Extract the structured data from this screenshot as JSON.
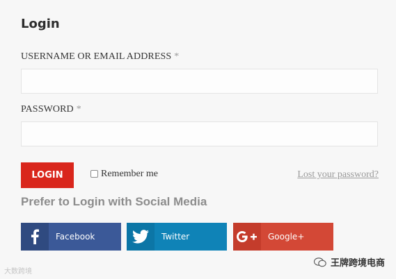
{
  "form": {
    "title": "Login",
    "username_label": "USERNAME OR EMAIL ADDRESS",
    "required_mark": "*",
    "username_value": "",
    "password_label": "PASSWORD",
    "password_value": "",
    "login_button": "LOGIN",
    "remember_label": "Remember me",
    "remember_checked": false,
    "lost_password": "Lost your password?"
  },
  "social": {
    "heading": "Prefer to Login with Social Media",
    "buttons": [
      {
        "label": "Facebook",
        "icon": "facebook-icon",
        "color": "#3b5998"
      },
      {
        "label": "Twitter",
        "icon": "twitter-icon",
        "color": "#0f83b7"
      },
      {
        "label": "Google+",
        "icon": "google-plus-icon",
        "color": "#d34836"
      }
    ]
  },
  "watermarks": {
    "left": "大数跨境",
    "right": "王牌跨境电商"
  }
}
